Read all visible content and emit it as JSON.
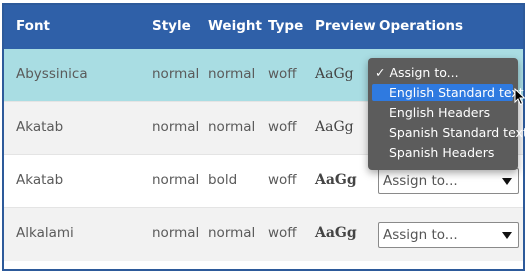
{
  "header": {
    "font": "Font",
    "style": "Style",
    "weight": "Weight",
    "type": "Type",
    "preview": "Preview",
    "operations": "Operations"
  },
  "rows": [
    {
      "font": "Abyssinica",
      "style": "normal",
      "weight": "normal",
      "type": "woff",
      "preview": "AaGg",
      "selected": true
    },
    {
      "font": "Akatab",
      "style": "normal",
      "weight": "normal",
      "type": "woff",
      "preview": "AaGg"
    },
    {
      "font": "Akatab",
      "style": "normal",
      "weight": "bold",
      "type": "woff",
      "preview": "AaGg",
      "operation": "Assign to..."
    },
    {
      "font": "Alkalami",
      "style": "normal",
      "weight": "normal",
      "type": "woff",
      "preview": "AaGg",
      "operation": "Assign to..."
    }
  ],
  "dropdown": {
    "checked_item": "✓ Assign to...",
    "items": [
      "English Standard text",
      "English Headers",
      "Spanish Standard text",
      "Spanish Headers"
    ],
    "highlighted_index": 0
  },
  "colors": {
    "header_bg": "#2f60a8",
    "selected_row_bg": "#a9dde3",
    "alt_row_bg": "#f2f2f2",
    "menu_bg": "#5c5c5c",
    "menu_highlight": "#2f7ae0"
  },
  "icons": {
    "cursor": "arrow-cursor-icon",
    "select_arrow": "triangle-down-icon"
  }
}
